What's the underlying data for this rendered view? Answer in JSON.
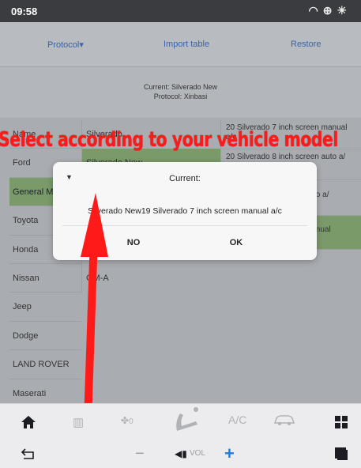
{
  "status": {
    "time": "09:58"
  },
  "tabs": {
    "protocol": "Protocol▾",
    "import": "Import table",
    "restore": "Restore"
  },
  "current": {
    "line1": "Current:  Silverado New",
    "line2": "Protocol:   Xinbasi"
  },
  "brands": [
    "Name",
    "Ford",
    "General M",
    "Toyota",
    "Honda",
    "Nissan",
    "Jeep",
    "Dodge",
    "LAND ROVER",
    "Maserati"
  ],
  "models": [
    "Silverado",
    "Silverado New",
    "",
    "",
    "",
    "GM-A"
  ],
  "details": [
    "20 Silverado 7 inch screen manual a/c",
    "20 Silverado 8 inch screen auto a/",
    "en auto a/",
    "en manual"
  ],
  "annotation": "Select according to your vehicle model",
  "dialog": {
    "title": "Current:",
    "message": "Silverado New19 Silverado 7 inch screen manual a/c",
    "no": "NO",
    "ok": "OK"
  },
  "bottom": {
    "fan_level": "0",
    "ac": "A/C",
    "vol": "VOL"
  },
  "colors": {
    "accent": "#3a63a8",
    "selected_row": "#7a9a6a",
    "annotation": "#ff1a1a",
    "vol_plus": "#1e7be0"
  }
}
